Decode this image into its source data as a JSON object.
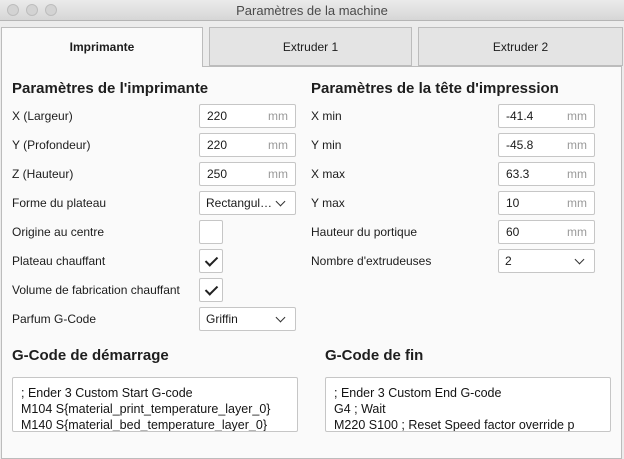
{
  "window": {
    "title": "Paramètres de la machine"
  },
  "tabs": [
    {
      "label": "Imprimante",
      "active": true
    },
    {
      "label": "Extruder 1",
      "active": false
    },
    {
      "label": "Extruder 2",
      "active": false
    }
  ],
  "printer": {
    "heading": "Paramètres de l'imprimante",
    "width": {
      "label": "X (Largeur)",
      "value": "220",
      "unit": "mm"
    },
    "depth": {
      "label": "Y (Profondeur)",
      "value": "220",
      "unit": "mm"
    },
    "height": {
      "label": "Z (Hauteur)",
      "value": "250",
      "unit": "mm"
    },
    "bed_shape": {
      "label": "Forme du plateau",
      "value": "Rectangul…"
    },
    "origin_center": {
      "label": "Origine au centre",
      "checked": false
    },
    "heated_bed": {
      "label": "Plateau chauffant",
      "checked": true
    },
    "heated_volume": {
      "label": "Volume de fabrication chauffant",
      "checked": true
    },
    "gcode_flavor": {
      "label": "Parfum G-Code",
      "value": "Griffin"
    }
  },
  "head": {
    "heading": "Paramètres de la tête d'impression",
    "x_min": {
      "label": "X min",
      "value": "-41.4",
      "unit": "mm"
    },
    "y_min": {
      "label": "Y min",
      "value": "-45.8",
      "unit": "mm"
    },
    "x_max": {
      "label": "X max",
      "value": "63.3",
      "unit": "mm"
    },
    "y_max": {
      "label": "Y max",
      "value": "10",
      "unit": "mm"
    },
    "gantry_height": {
      "label": "Hauteur du portique",
      "value": "60",
      "unit": "mm"
    },
    "extruder_count": {
      "label": "Nombre d'extrudeuses",
      "value": "2"
    }
  },
  "start_gcode": {
    "heading": "G-Code de démarrage",
    "lines": [
      "; Ender 3 Custom Start G-code",
      "M104 S{material_print_temperature_layer_0}",
      "M140 S{material_bed_temperature_layer_0}"
    ]
  },
  "end_gcode": {
    "heading": "G-Code de fin",
    "lines": [
      "; Ender 3 Custom End G-code",
      "G4 ; Wait",
      "M220 S100 ; Reset Speed factor override p"
    ]
  }
}
